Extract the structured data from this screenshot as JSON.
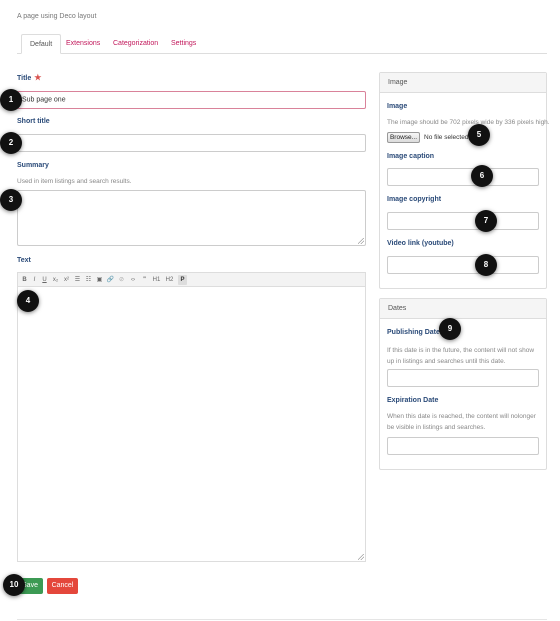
{
  "page": {
    "subtitle": "A page using Deco layout"
  },
  "tabs": [
    {
      "label": "Default"
    },
    {
      "label": "Extensions"
    },
    {
      "label": "Categorization"
    },
    {
      "label": "Settings"
    }
  ],
  "form": {
    "title": {
      "label": "Title",
      "required_mark": "★",
      "value": "Sub page one"
    },
    "short_title": {
      "label": "Short title",
      "value": ""
    },
    "summary": {
      "label": "Summary",
      "help": "Used in item listings and search results.",
      "value": ""
    },
    "text": {
      "label": "Text",
      "toolbar": [
        "B",
        "I",
        "U",
        "x₂",
        "x²",
        "☰",
        "☷",
        "▣",
        "🔗",
        "⊘",
        "‹›",
        "\"",
        "H1",
        "H2",
        "P"
      ]
    },
    "save_label": "Save",
    "cancel_label": "Cancel"
  },
  "image_panel": {
    "heading": "Image",
    "image": {
      "label": "Image",
      "help": "The image should be 702 pixels wide by 336 pixels high.",
      "browse_label": "Browse...",
      "file_status": "No file selected."
    },
    "caption": {
      "label": "Image caption",
      "value": ""
    },
    "copyright": {
      "label": "Image copyright",
      "value": ""
    },
    "video": {
      "label": "Video link (youtube)",
      "value": ""
    }
  },
  "dates_panel": {
    "heading": "Dates",
    "publishing": {
      "label": "Publishing Date",
      "help": "If this date is in the future, the content will not show up in listings and searches until this date.",
      "value": ""
    },
    "expiration": {
      "label": "Expiration Date",
      "help": "When this date is reached, the content will nolonger be visible in listings and searches.",
      "value": ""
    }
  },
  "markers": [
    "1",
    "2",
    "3",
    "4",
    "5",
    "6",
    "7",
    "8",
    "9",
    "10"
  ],
  "colors": {
    "tab_link": "#c2185b",
    "label": "#2a4a78",
    "save": "#3c9a54",
    "cancel": "#e4473b",
    "error_border": "#d9829a"
  }
}
